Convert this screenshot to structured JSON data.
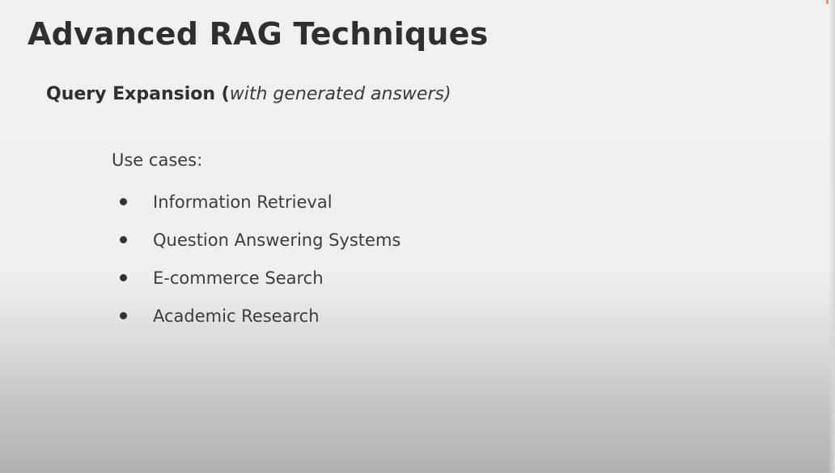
{
  "slide": {
    "title": "Advanced RAG Techniques",
    "subtitle_main": "Query Expansion (",
    "subtitle_note": "with generated answers)",
    "use_cases_label": "Use cases:",
    "bullets": [
      "Information Retrieval",
      "Question Answering Systems",
      "E-commerce Search",
      "Academic Research"
    ]
  },
  "colors": {
    "title_text": "#2f2f2f",
    "body_text": "#3c3c3c",
    "background_top": "#f0f0f0",
    "background_bottom": "#b2b2b2"
  }
}
